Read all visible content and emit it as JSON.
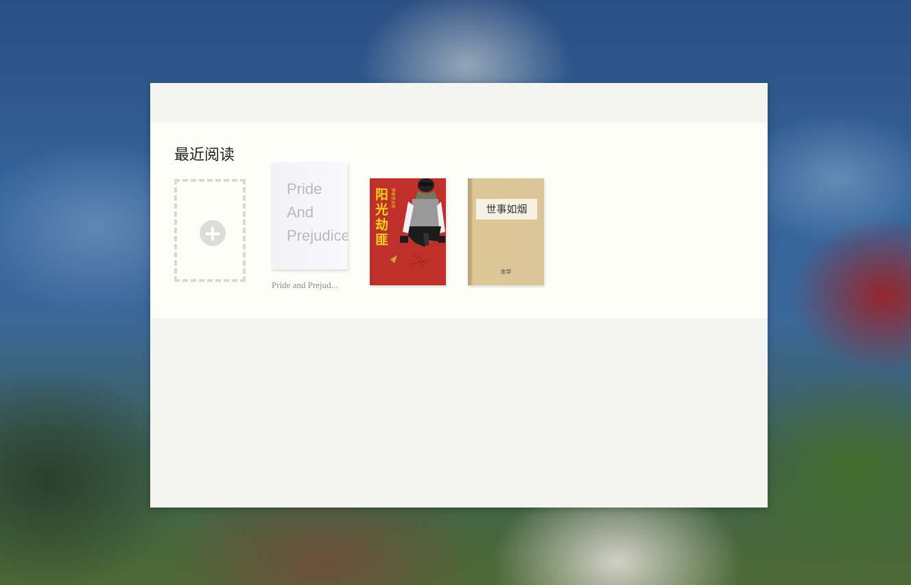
{
  "shelf": {
    "title": "最近阅读",
    "add_icon": "plus-circle-icon",
    "books": [
      {
        "cover_text": "Pride\nAnd\nPrejudice",
        "caption": "Pride and Prejud..."
      },
      {
        "cover_title": "阳光劫匪",
        "cover_author": "伊坂幸太郎"
      },
      {
        "cover_title": "世事如烟",
        "cover_author": "余华"
      }
    ]
  },
  "colors": {
    "window_bg": "#f4f4f1",
    "shelf_bg": "#fefef9",
    "book2_cover": "#c0302a",
    "book3_cover": "#dcc796"
  }
}
